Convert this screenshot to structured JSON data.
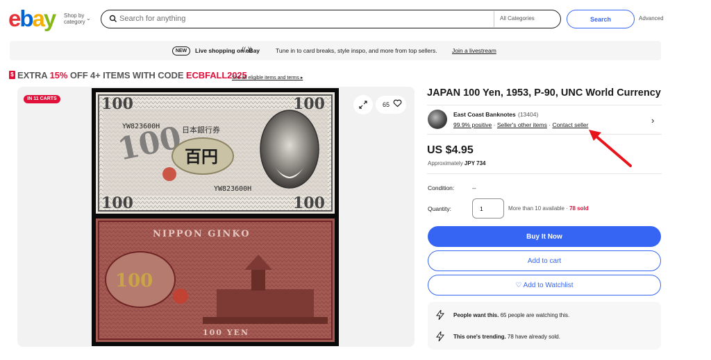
{
  "header": {
    "logo_letters": [
      {
        "ch": "e",
        "color": "#e53238"
      },
      {
        "ch": "b",
        "color": "#0064d2"
      },
      {
        "ch": "a",
        "color": "#f5af02"
      },
      {
        "ch": "y",
        "color": "#86b817"
      }
    ],
    "shop_by_line1": "Shop by",
    "shop_by_line2": "category",
    "search_placeholder": "Search for anything",
    "category_label": "All Categories",
    "search_button": "Search",
    "advanced_link": "Advanced"
  },
  "banner": {
    "new_badge": "NEW",
    "strong": "Live shopping on eBay",
    "icon": "((·))",
    "text": "Tune in to card breaks, style inspo, and more from top sellers.",
    "link": "Join a livestream"
  },
  "coupon": {
    "icon": "$",
    "prefix": "EXTRA ",
    "percent": "15%",
    "middle": " OFF 4+ ITEMS WITH CODE ",
    "code": "ECBFALL2025",
    "link": "See all eligible items and terms ▸"
  },
  "gallery": {
    "carts_badge": "IN 11 CARTS",
    "watch_count": "65",
    "note_front": {
      "serial": "YW823600H",
      "bank": "日本銀行券",
      "denom_kanji": "百円",
      "corner_value": "100"
    },
    "note_back": {
      "title": "NIPPON GINKO",
      "value": "100",
      "yen": "100 YEN"
    }
  },
  "item": {
    "title": "JAPAN 100 Yen, 1953, P-90, UNC World Currency",
    "seller": {
      "name": "East Coast Banknotes",
      "count": "(13404)",
      "positive": "99.9% positive",
      "other_items": "Seller's other items",
      "contact": "Contact seller"
    },
    "price": "US $4.95",
    "approx_label": "Approximately ",
    "approx_value": "JPY 734",
    "condition_label": "Condition:",
    "condition_value": "--",
    "quantity_label": "Quantity:",
    "quantity_value": "1",
    "availability": "More than 10 available · ",
    "sold": "78 sold",
    "buy_now": "Buy It Now",
    "add_to_cart": "Add to cart",
    "add_to_watchlist": "♡ Add to Watchlist",
    "signals": [
      {
        "strong": "People want this.",
        "text": " 65 people are watching this."
      },
      {
        "strong": "This one's trending.",
        "text": " 78 have already sold."
      }
    ]
  },
  "colors": {
    "brand_blue": "#3665f3",
    "alert_red": "#e0103a",
    "annotation_arrow": "#e8141c"
  }
}
